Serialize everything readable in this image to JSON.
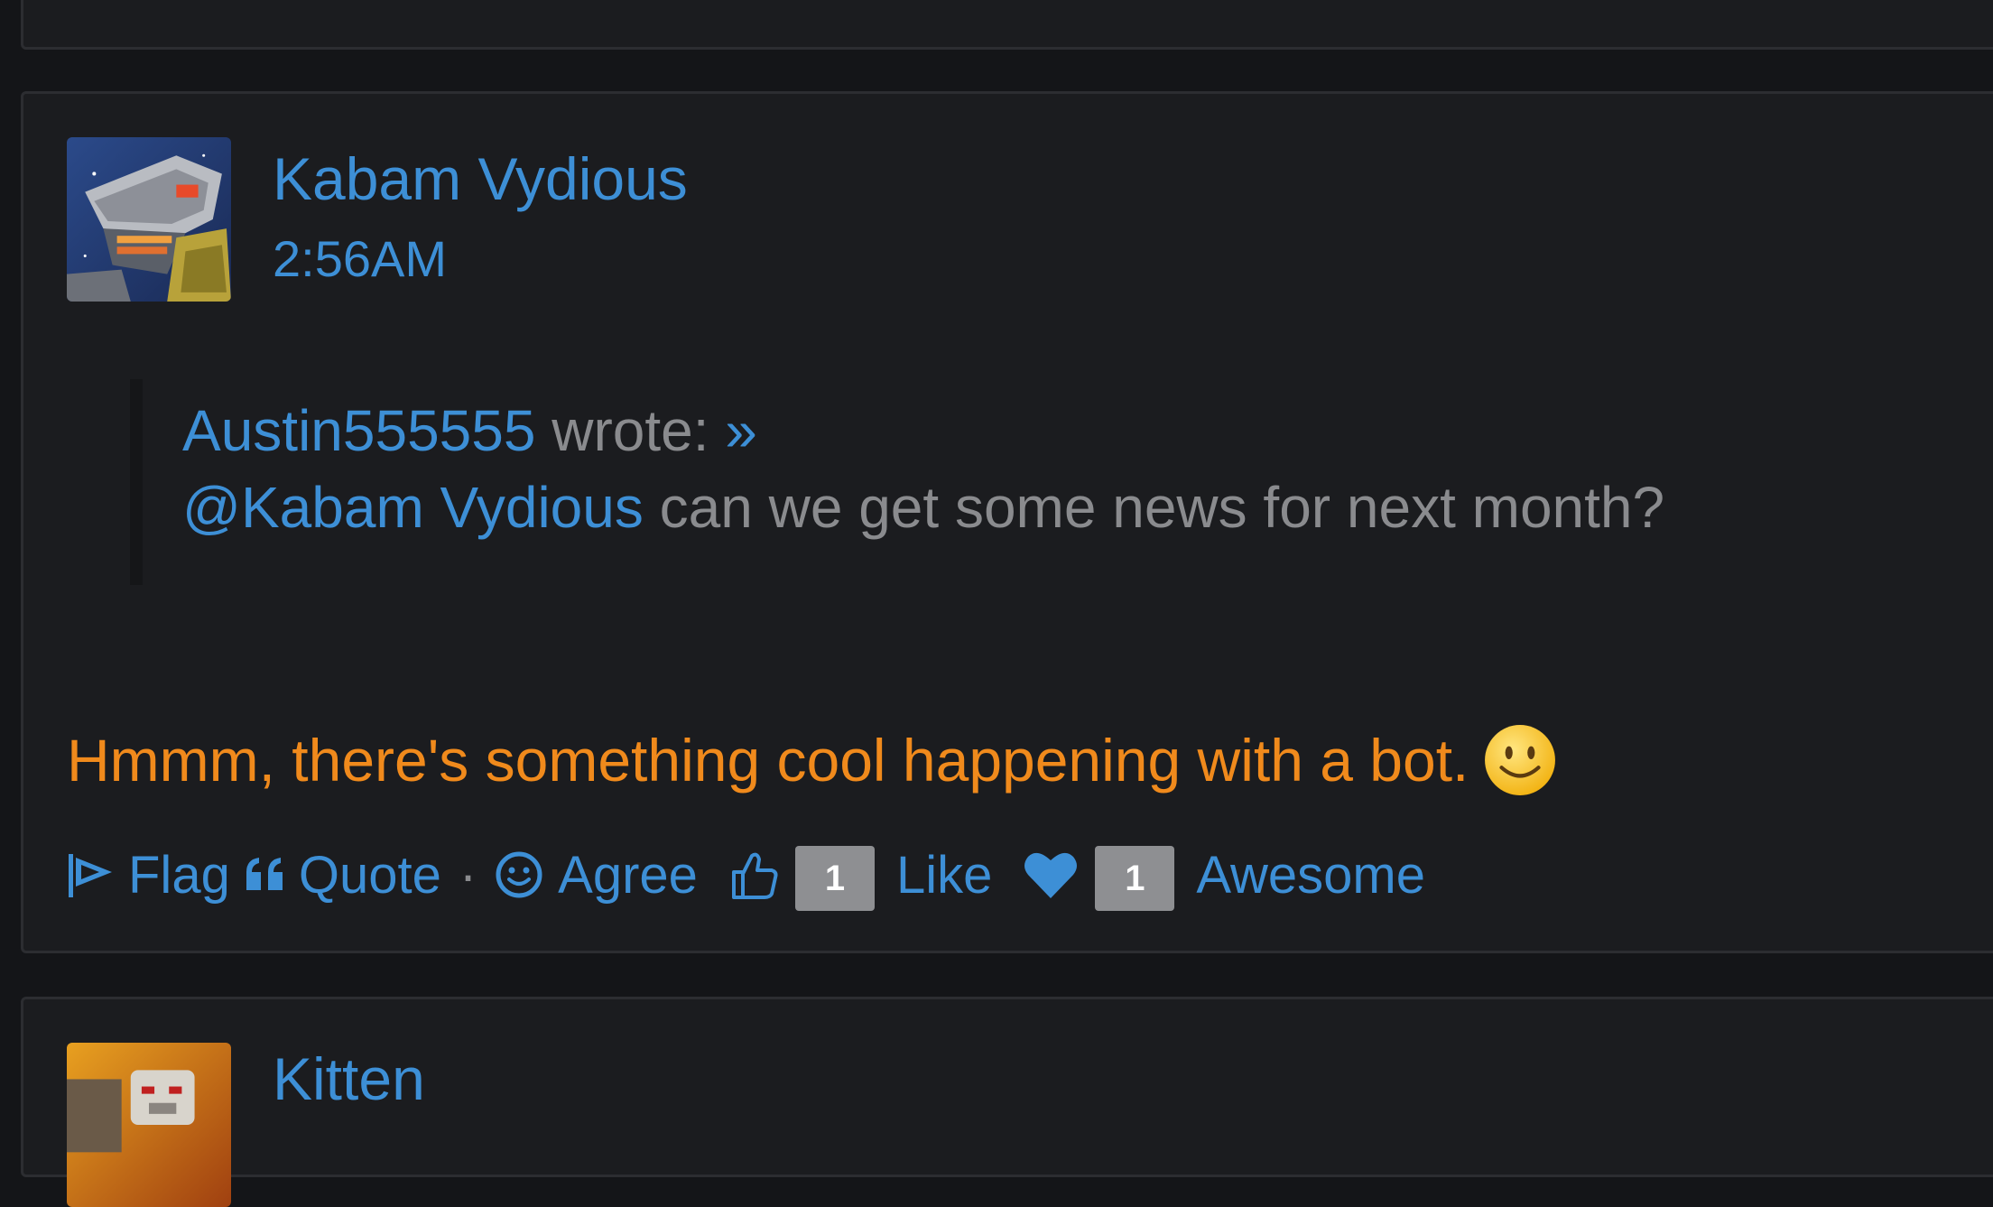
{
  "post": {
    "author": "Kabam Vydious",
    "timestamp": "2:56AM",
    "quote": {
      "author": "Austin555555",
      "wrote_label": "wrote:",
      "jump_link": "»",
      "mention": "@Kabam Vydious",
      "text": "can we get some news for next month?"
    },
    "body": "Hmmm, there's something cool happening with a bot.",
    "actions": {
      "flag": "Flag",
      "quote": "Quote",
      "separator": "·",
      "agree": "Agree",
      "like_count": "1",
      "like": "Like",
      "awesome_count": "1",
      "awesome": "Awesome"
    }
  },
  "next_post": {
    "author": "Kitten"
  },
  "colors": {
    "link": "#3d8fd6",
    "body_text": "#f08a1c",
    "muted": "#8a8b8e",
    "background": "#141518",
    "panel": "#1b1c1f"
  },
  "icons": [
    "flag-icon",
    "quote-icon",
    "smiley-icon",
    "thumbs-up-icon",
    "heart-icon"
  ]
}
